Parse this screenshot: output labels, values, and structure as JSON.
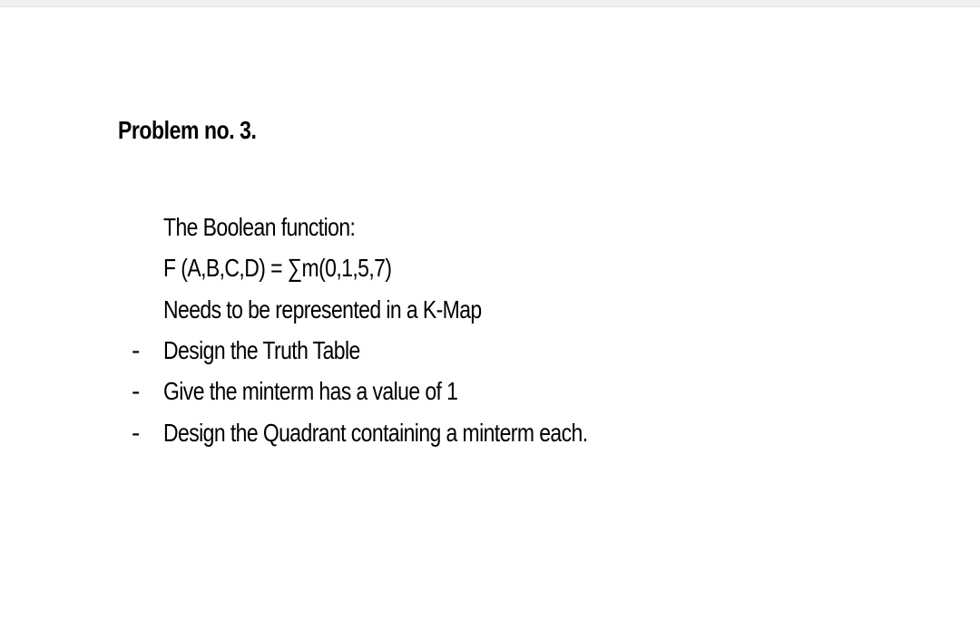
{
  "heading": "Problem no. 3.",
  "intro": {
    "line1": "The Boolean function:",
    "line2": "F (A,B,C,D) = ∑m(0,1,5,7)",
    "line3": "Needs to be represented in a K-Map"
  },
  "bullets": [
    "Design the Truth Table",
    "Give the minterm has a value of 1",
    "Design the Quadrant containing a minterm each."
  ]
}
